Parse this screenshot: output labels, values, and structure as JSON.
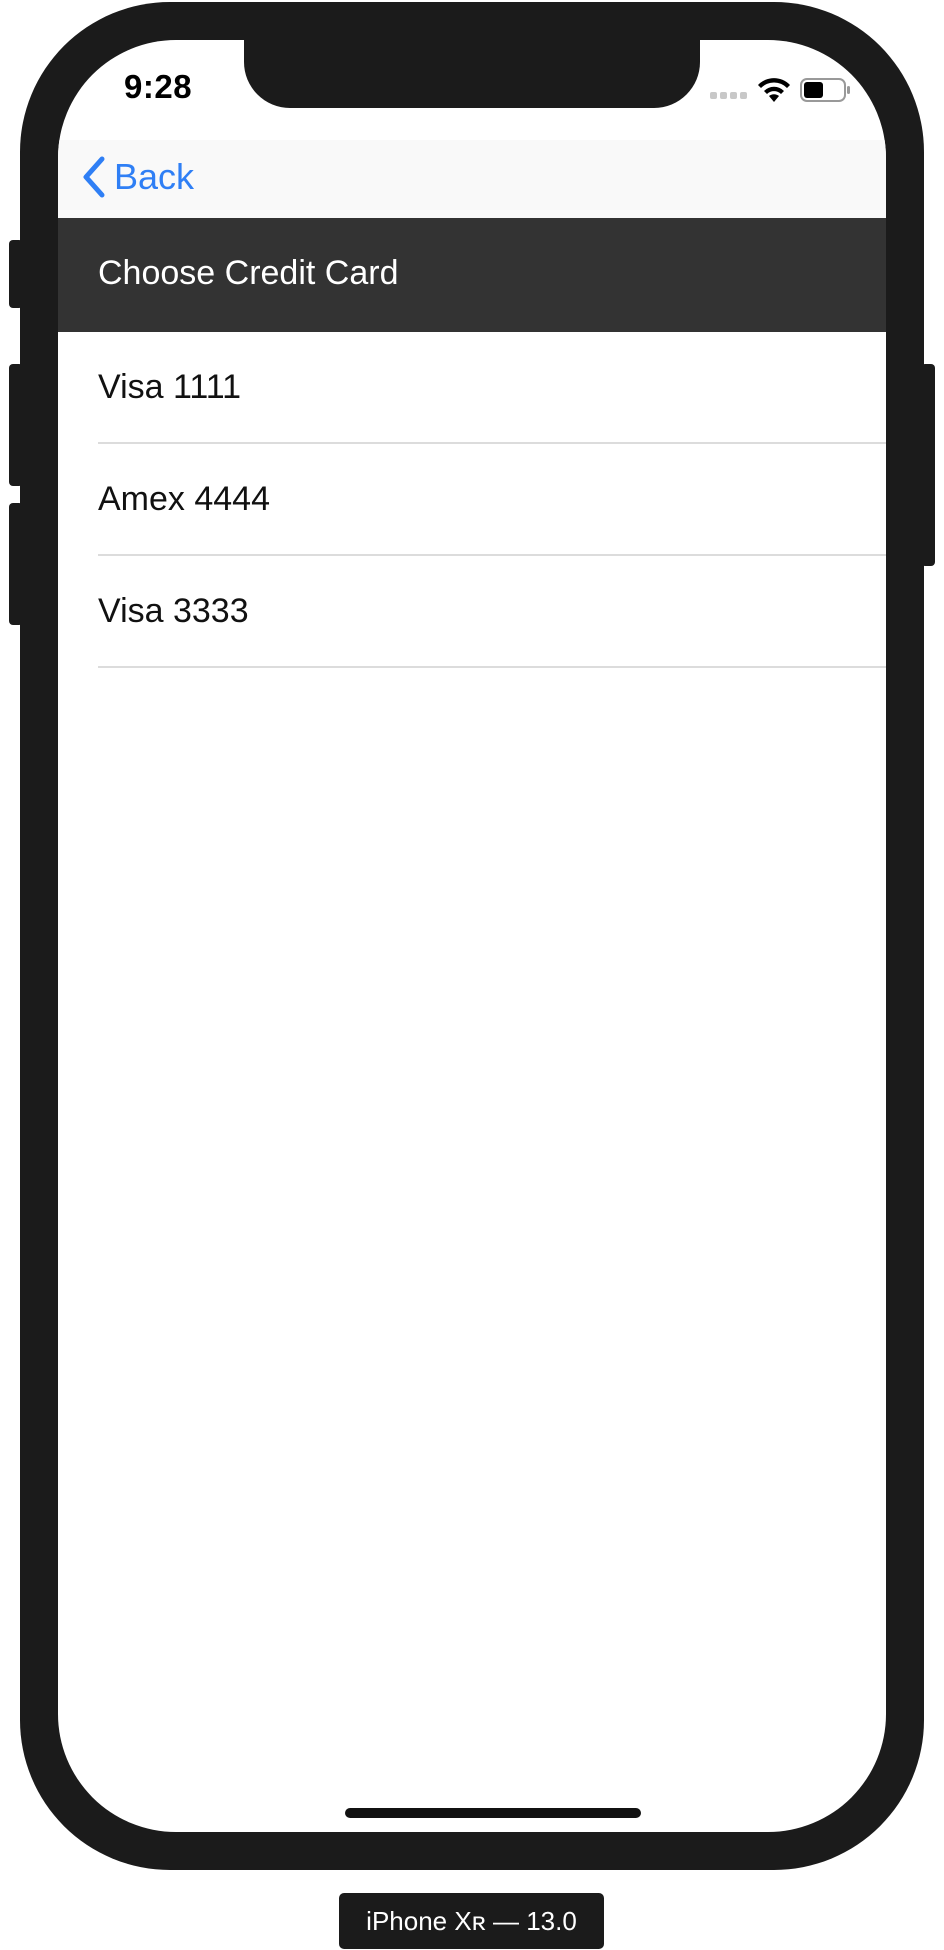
{
  "status_bar": {
    "time": "9:28",
    "icons": [
      "cellular-signal-icon",
      "wifi-icon",
      "battery-icon"
    ]
  },
  "nav": {
    "back_label": "Back",
    "accent_color": "#2f7ff5"
  },
  "header": {
    "title": "Choose Credit Card",
    "background_color": "#333333"
  },
  "cards": [
    {
      "label": "Visa 1111"
    },
    {
      "label": "Amex 4444"
    },
    {
      "label": "Visa 3333"
    }
  ],
  "device": {
    "caption": "iPhone Xʀ — 13.0"
  }
}
